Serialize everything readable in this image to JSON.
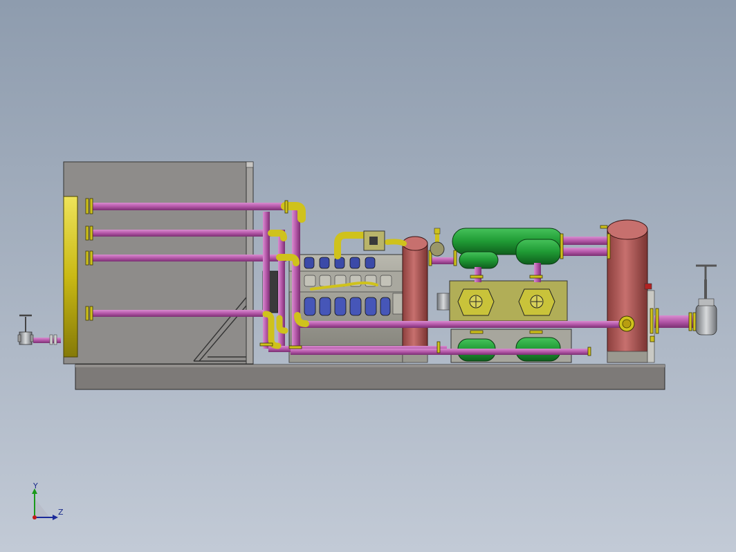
{
  "triad": {
    "y_label": "Y",
    "z_label": "Z"
  },
  "colors": {
    "background_top": "#8e9cae",
    "background_bottom": "#c2cad6",
    "pipe_magenta": "#b457a8",
    "pipe_yellow": "#d0c21c",
    "vessel_red": "#b05a58",
    "tank_green": "#1f9a34",
    "skid_gray": "#7d7a78",
    "enclosure_gray": "#8e8c8a",
    "engine_blue": "#3b4aa8"
  }
}
